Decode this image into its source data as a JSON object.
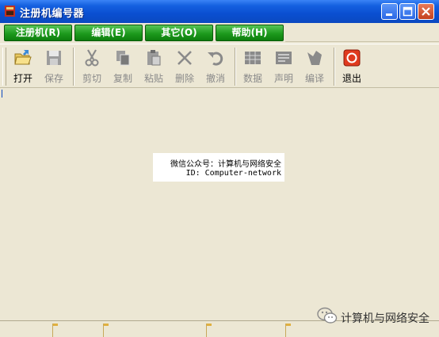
{
  "window": {
    "title": "注册机编号器"
  },
  "menu": [
    {
      "label": "注册机(R)"
    },
    {
      "label": "编辑(E)"
    },
    {
      "label": "其它(O)"
    },
    {
      "label": "帮助(H)"
    }
  ],
  "toolbar": {
    "open": "打开",
    "save": "保存",
    "cut": "剪切",
    "copy": "复制",
    "paste": "粘贴",
    "delete": "删除",
    "undo": "撤消",
    "data": "数据",
    "statement": "声明",
    "compile": "编译",
    "exit": "退出"
  },
  "content": {
    "line1": "微信公众号：计算机与网络安全",
    "line2": "ID: Computer-network"
  },
  "overlay": {
    "text": "计算机与网络安全"
  },
  "colors": {
    "titlebar": "#0b49c0",
    "menu_green": "#1d9a1d",
    "exit_red": "#e03a1e",
    "face": "#ece7d4"
  }
}
